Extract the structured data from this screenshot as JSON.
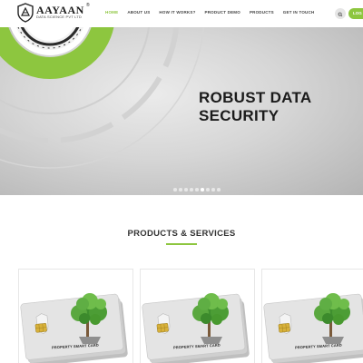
{
  "header": {
    "logo_name": "AAYAAN",
    "logo_tagline": "DATA SCIENCE PVT LTD",
    "logo_mark": "®",
    "nav": [
      {
        "label": "HOME",
        "active": true
      },
      {
        "label": "ABOUT US",
        "active": false
      },
      {
        "label": "HOW IT WORKS?",
        "active": false
      },
      {
        "label": "PRODUCT DEMO",
        "active": false
      },
      {
        "label": "PRODUCTS",
        "active": false
      },
      {
        "label": "GET IN TOUCH",
        "active": false
      }
    ],
    "cta_label": "LOG",
    "accent_color": "#8dc63f"
  },
  "hero": {
    "title_line1": "ROBUST DATA",
    "title_line2": "SECURITY",
    "slides_count": 9,
    "active_slide": 5
  },
  "products": {
    "section_title": "PRODUCTS & SERVICES",
    "cards": [
      {
        "label": "PROPERTY SMART CARD",
        "image": "smart-card-tree"
      },
      {
        "label": "PROPERTY SMART CARD",
        "image": "smart-card-tree"
      },
      {
        "label": "PROPERTY SMART CARD",
        "image": "smart-card-tree"
      }
    ]
  }
}
